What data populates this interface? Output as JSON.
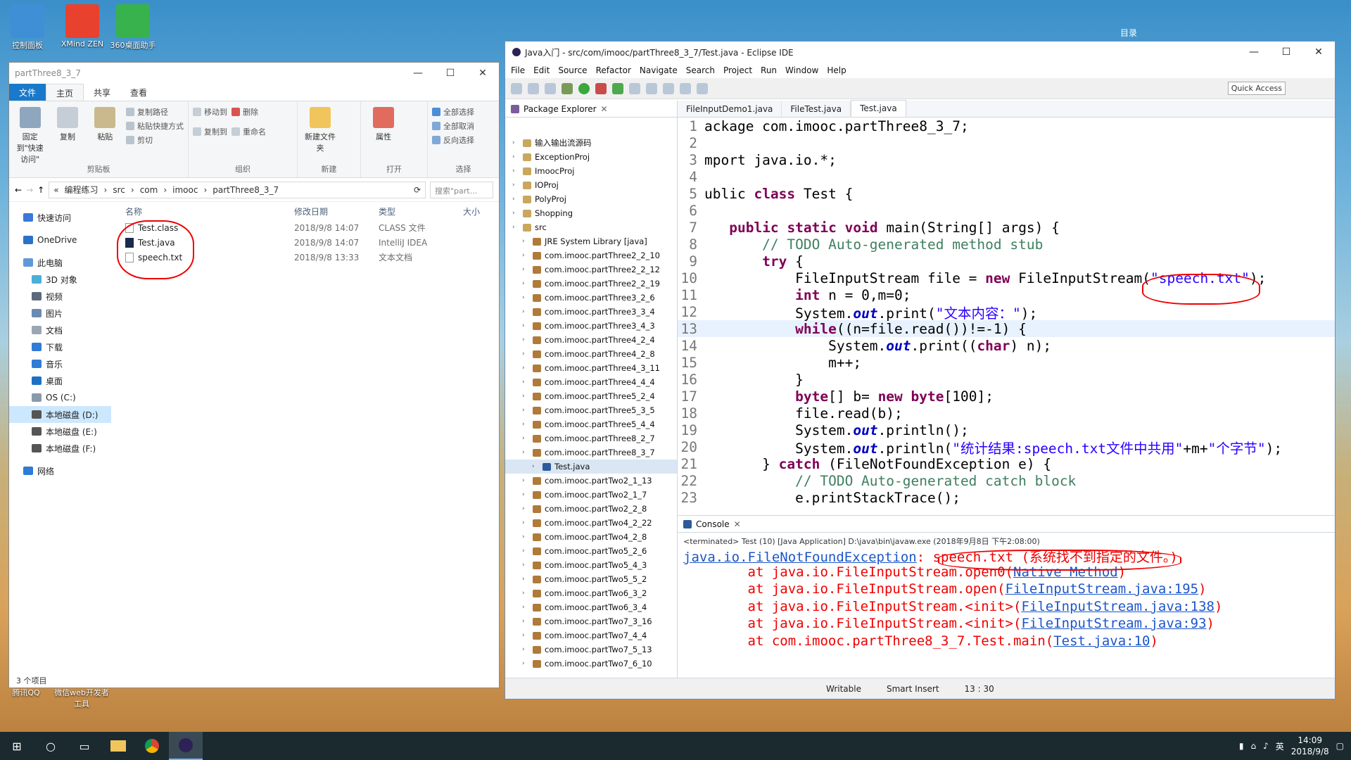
{
  "desktop": {
    "icons": [
      {
        "label": "控制面板"
      },
      {
        "label": "XMind ZEN"
      },
      {
        "label": "360桌面助手"
      },
      {
        "label": "腾讯QQ"
      },
      {
        "label": "微信web开发者工具"
      }
    ],
    "corner_label": "目录"
  },
  "explorer": {
    "title": "partThree8_3_7",
    "ribbon_tabs": [
      "文件",
      "主页",
      "共享",
      "查看"
    ],
    "groups": {
      "clipboard": {
        "name": "剪贴板",
        "pin": "固定到\"快速访问\"",
        "copy": "复制",
        "paste": "粘贴",
        "copy_path": "复制路径",
        "paste_shortcut": "粘贴快捷方式",
        "cut": "剪切"
      },
      "organize": {
        "name": "组织",
        "move_to": "移动到",
        "copy_to": "复制到",
        "delete": "删除",
        "rename": "重命名"
      },
      "new": {
        "name": "新建",
        "new_folder": "新建文件夹"
      },
      "open": {
        "name": "打开",
        "properties": "属性"
      },
      "select": {
        "name": "选择",
        "select_all": "全部选择",
        "select_none": "全部取消",
        "invert": "反向选择"
      }
    },
    "breadcrumb": [
      "«",
      "编程练习",
      "src",
      "com",
      "imooc",
      "partThree8_3_7"
    ],
    "search_placeholder": "搜索\"part...",
    "nav": [
      {
        "label": "快速访问"
      },
      {
        "label": "OneDrive"
      },
      {
        "label": "此电脑"
      },
      {
        "label": "3D 对象"
      },
      {
        "label": "视频"
      },
      {
        "label": "图片"
      },
      {
        "label": "文档"
      },
      {
        "label": "下载"
      },
      {
        "label": "音乐"
      },
      {
        "label": "桌面"
      },
      {
        "label": "OS (C:)"
      },
      {
        "label": "本地磁盘 (D:)"
      },
      {
        "label": "本地磁盘 (E:)"
      },
      {
        "label": "本地磁盘 (F:)"
      },
      {
        "label": "网络"
      }
    ],
    "columns": [
      "名称",
      "修改日期",
      "类型",
      "大小"
    ],
    "files": [
      {
        "name": "Test.class",
        "date": "2018/9/8 14:07",
        "type": "CLASS 文件"
      },
      {
        "name": "Test.java",
        "date": "2018/9/8 14:07",
        "type": "IntelliJ IDEA"
      },
      {
        "name": "speech.txt",
        "date": "2018/9/8 13:33",
        "type": "文本文档"
      }
    ],
    "status": "3 个项目"
  },
  "eclipse": {
    "title": "Java入门 - src/com/imooc/partThree8_3_7/Test.java - Eclipse IDE",
    "menu": [
      "File",
      "Edit",
      "Source",
      "Refactor",
      "Navigate",
      "Search",
      "Project",
      "Run",
      "Window",
      "Help"
    ],
    "quick_access": "Quick Access",
    "package_explorer": {
      "title": "Package Explorer",
      "items": [
        {
          "label": "输入输出流源码",
          "indent": 0
        },
        {
          "label": "ExceptionProj",
          "indent": 0
        },
        {
          "label": "ImoocProj",
          "indent": 0
        },
        {
          "label": "IOProj",
          "indent": 0
        },
        {
          "label": "PolyProj",
          "indent": 0
        },
        {
          "label": "Shopping",
          "indent": 0
        },
        {
          "label": "src",
          "indent": 0
        },
        {
          "label": "JRE System Library [java]",
          "indent": 1
        },
        {
          "label": "com.imooc.partThree2_2_10",
          "indent": 1
        },
        {
          "label": "com.imooc.partThree2_2_12",
          "indent": 1
        },
        {
          "label": "com.imooc.partThree2_2_19",
          "indent": 1
        },
        {
          "label": "com.imooc.partThree3_2_6",
          "indent": 1
        },
        {
          "label": "com.imooc.partThree3_3_4",
          "indent": 1
        },
        {
          "label": "com.imooc.partThree3_4_3",
          "indent": 1
        },
        {
          "label": "com.imooc.partThree4_2_4",
          "indent": 1
        },
        {
          "label": "com.imooc.partThree4_2_8",
          "indent": 1
        },
        {
          "label": "com.imooc.partThree4_3_11",
          "indent": 1
        },
        {
          "label": "com.imooc.partThree4_4_4",
          "indent": 1
        },
        {
          "label": "com.imooc.partThree5_2_4",
          "indent": 1
        },
        {
          "label": "com.imooc.partThree5_3_5",
          "indent": 1
        },
        {
          "label": "com.imooc.partThree5_4_4",
          "indent": 1
        },
        {
          "label": "com.imooc.partThree8_2_7",
          "indent": 1
        },
        {
          "label": "com.imooc.partThree8_3_7",
          "indent": 1
        },
        {
          "label": "Test.java",
          "indent": 2
        },
        {
          "label": "com.imooc.partTwo2_1_13",
          "indent": 1
        },
        {
          "label": "com.imooc.partTwo2_1_7",
          "indent": 1
        },
        {
          "label": "com.imooc.partTwo2_2_8",
          "indent": 1
        },
        {
          "label": "com.imooc.partTwo4_2_22",
          "indent": 1
        },
        {
          "label": "com.imooc.partTwo4_2_8",
          "indent": 1
        },
        {
          "label": "com.imooc.partTwo5_2_6",
          "indent": 1
        },
        {
          "label": "com.imooc.partTwo5_4_3",
          "indent": 1
        },
        {
          "label": "com.imooc.partTwo5_5_2",
          "indent": 1
        },
        {
          "label": "com.imooc.partTwo6_3_2",
          "indent": 1
        },
        {
          "label": "com.imooc.partTwo6_3_4",
          "indent": 1
        },
        {
          "label": "com.imooc.partTwo7_3_16",
          "indent": 1
        },
        {
          "label": "com.imooc.partTwo7_4_4",
          "indent": 1
        },
        {
          "label": "com.imooc.partTwo7_5_13",
          "indent": 1
        },
        {
          "label": "com.imooc.partTwo7_6_10",
          "indent": 1
        }
      ]
    },
    "editor_tabs": [
      "FileInputDemo1.java",
      "FileTest.java",
      "Test.java"
    ],
    "code_lines": [
      {
        "n": "1",
        "t": "ackage com.imooc.partThree8_3_7;"
      },
      {
        "n": "2",
        "t": ""
      },
      {
        "n": "3",
        "t": "mport java.io.*;"
      },
      {
        "n": "4",
        "t": ""
      },
      {
        "n": "5",
        "t": "ublic class Test {"
      },
      {
        "n": "6",
        "t": ""
      },
      {
        "n": "7",
        "t": "   public static void main(String[] args) {"
      },
      {
        "n": "8",
        "t": "       // TODO Auto-generated method stub"
      },
      {
        "n": "9",
        "t": "       try {"
      },
      {
        "n": "10",
        "t": "           FileInputStream file = new FileInputStream(\"speech.txt\");"
      },
      {
        "n": "11",
        "t": "           int n = 0,m=0;"
      },
      {
        "n": "12",
        "t": "           System.out.print(\"文本内容：\");"
      },
      {
        "n": "13",
        "t": "           while((n=file.read())!=-1) {"
      },
      {
        "n": "14",
        "t": "               System.out.print((char) n);"
      },
      {
        "n": "15",
        "t": "               m++;"
      },
      {
        "n": "16",
        "t": "           }"
      },
      {
        "n": "17",
        "t": "           byte[] b= new byte[100];"
      },
      {
        "n": "18",
        "t": "           file.read(b);"
      },
      {
        "n": "19",
        "t": "           System.out.println();"
      },
      {
        "n": "20",
        "t": "           System.out.println(\"统计结果:speech.txt文件中共用\"+m+\"个字节\");"
      },
      {
        "n": "21",
        "t": "       } catch (FileNotFoundException e) {"
      },
      {
        "n": "22",
        "t": "           // TODO Auto-generated catch block"
      },
      {
        "n": "23",
        "t": "           e.printStackTrace();"
      }
    ],
    "console": {
      "title": "Console",
      "terminated": "<terminated> Test (10) [Java Application] D:\\java\\bin\\javaw.exe (2018年9月8日 下午2:08:00)",
      "exception_class": "java.io.FileNotFoundException",
      "exception_msg": ": speech.txt (系统找不到指定的文件。)",
      "frames": [
        {
          "prefix": "        at java.io.FileInputStream.open0(",
          "link": "Native Method",
          "suffix": ")"
        },
        {
          "prefix": "        at java.io.FileInputStream.open(",
          "link": "FileInputStream.java:195",
          "suffix": ")"
        },
        {
          "prefix": "        at java.io.FileInputStream.<init>(",
          "link": "FileInputStream.java:138",
          "suffix": ")"
        },
        {
          "prefix": "        at java.io.FileInputStream.<init>(",
          "link": "FileInputStream.java:93",
          "suffix": ")"
        },
        {
          "prefix": "        at com.imooc.partThree8_3_7.Test.main(",
          "link": "Test.java:10",
          "suffix": ")"
        }
      ]
    },
    "status": {
      "writable": "Writable",
      "insert": "Smart Insert",
      "position": "13 : 30"
    }
  },
  "taskbar": {
    "ime": "英",
    "time": "14:09",
    "date": "2018/9/8"
  }
}
